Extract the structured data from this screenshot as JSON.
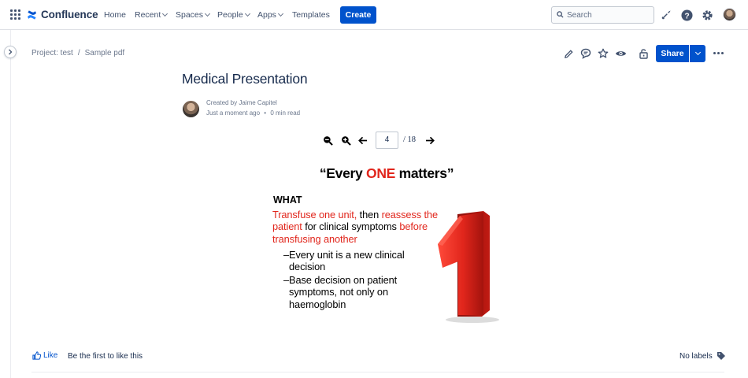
{
  "topnav": {
    "app_name": "Confluence",
    "items": [
      {
        "label": "Home",
        "has_menu": false
      },
      {
        "label": "Recent",
        "has_menu": true
      },
      {
        "label": "Spaces",
        "has_menu": true
      },
      {
        "label": "People",
        "has_menu": true
      },
      {
        "label": "Apps",
        "has_menu": true
      },
      {
        "label": "Templates",
        "has_menu": false
      }
    ],
    "create_label": "Create",
    "search_placeholder": "Search",
    "right_icons": [
      "notifications-icon",
      "help-icon",
      "settings-icon",
      "profile-avatar"
    ],
    "accent_color": "#0052cc"
  },
  "breadcrumb": [
    "Project: test",
    "Sample pdf"
  ],
  "page_actions": {
    "icons": [
      "edit-icon",
      "comment-icon",
      "star-icon",
      "watch-icon",
      "restrictions-icon"
    ],
    "share_label": "Share"
  },
  "page": {
    "title": "Medical Presentation",
    "created_by": "Created by Jaime Capitel",
    "updated": "Just a moment ago",
    "separator": "•",
    "read_time": "0 min read"
  },
  "pdf_viewer": {
    "current_page": "4",
    "page_total": "/ 18",
    "controls": [
      "zoom-out-icon",
      "zoom-in-icon",
      "previous-page-icon",
      "next-page-icon"
    ]
  },
  "slide": {
    "heading_before": "“Every ",
    "heading_highlight": "ONE",
    "heading_after": " matters”",
    "section": "WHAT",
    "p_red1": "Transfuse one unit,",
    "p_black1": " then ",
    "p_red2": "reassess the patient",
    "p_black2": " for clinical symptoms ",
    "p_red3": "before transfusing another",
    "bullet_dash": "–",
    "bullet1": "Every unit is a new clinical decision",
    "bullet2": "Base decision on patient symptoms, not only on haemoglobin",
    "highlight_color": "#e1261c"
  },
  "footer": {
    "like_label": "Like",
    "like_prompt": "Be the first to like this",
    "labels_text": "No labels"
  }
}
